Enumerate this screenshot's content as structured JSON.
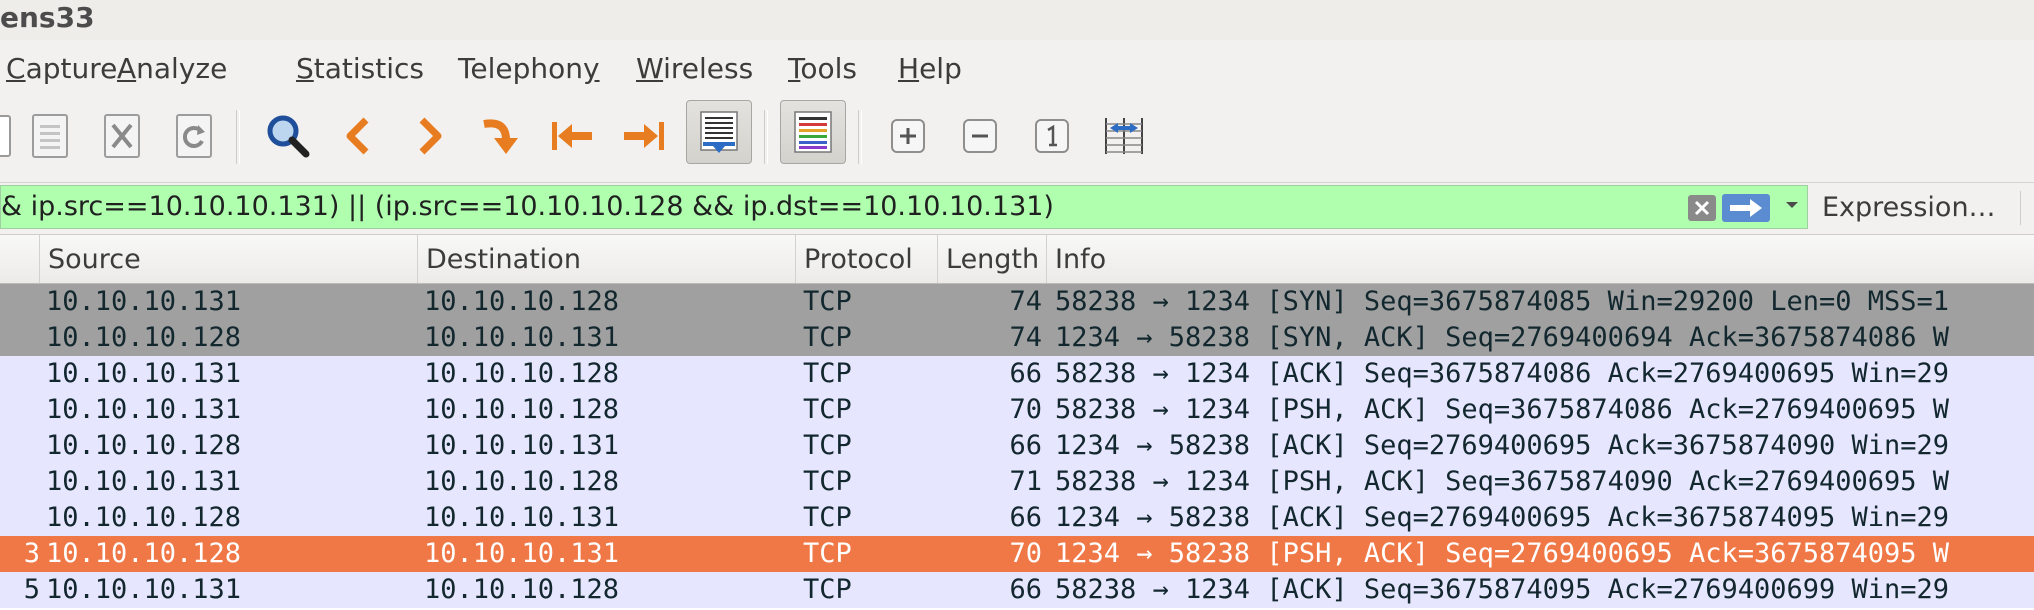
{
  "window": {
    "title": "ens33"
  },
  "menu": [
    {
      "label": "Capture",
      "mnemonic": "C",
      "rest": "apture"
    },
    {
      "label": "Analyze",
      "mnemonic": "A",
      "rest": "nalyze"
    },
    {
      "label": "Statistics",
      "mnemonic": "S",
      "rest": "tatistics"
    },
    {
      "label": "Telephony",
      "mnemonic": "y",
      "rest": "Telephon",
      "mnemonic_last": true
    },
    {
      "label": "Wireless",
      "mnemonic": "W",
      "rest": "ireless"
    },
    {
      "label": "Tools",
      "mnemonic": "T",
      "rest": "ools"
    },
    {
      "label": "Help",
      "mnemonic": "H",
      "rest": "elp"
    }
  ],
  "toolbar": {
    "icons": [
      "open-file-icon",
      "save-file-icon",
      "close-file-icon",
      "reload-icon",
      "find-packet-icon",
      "go-back-icon",
      "go-forward-icon",
      "go-to-packet-icon",
      "first-packet-icon",
      "last-packet-icon",
      "auto-scroll-icon",
      "colorize-icon",
      "zoom-in-icon",
      "zoom-out-icon",
      "normal-size-icon",
      "resize-columns-icon"
    ]
  },
  "filter": {
    "value": "& ip.src==10.10.10.131) || (ip.src==10.10.10.128  && ip.dst==10.10.10.131)",
    "expression_label": "Expression…"
  },
  "columns": {
    "source": "Source",
    "destination": "Destination",
    "protocol": "Protocol",
    "length": "Length",
    "info": "Info"
  },
  "rows": [
    {
      "no": "",
      "source": "10.10.10.131",
      "destination": "10.10.10.128",
      "protocol": "TCP",
      "length": "74",
      "info": "58238 → 1234 [SYN] Seq=3675874085 Win=29200 Len=0 MSS=1",
      "bg": "#a0a0a0",
      "fg": "#12272e"
    },
    {
      "no": "",
      "source": "10.10.10.128",
      "destination": "10.10.10.131",
      "protocol": "TCP",
      "length": "74",
      "info": "1234 → 58238 [SYN, ACK] Seq=2769400694 Ack=3675874086 W",
      "bg": "#a0a0a0",
      "fg": "#12272e"
    },
    {
      "no": "",
      "source": "10.10.10.131",
      "destination": "10.10.10.128",
      "protocol": "TCP",
      "length": "66",
      "info": "58238 → 1234 [ACK] Seq=3675874086 Ack=2769400695 Win=29",
      "bg": "#e7e6ff",
      "fg": "#12272e"
    },
    {
      "no": "",
      "source": "10.10.10.131",
      "destination": "10.10.10.128",
      "protocol": "TCP",
      "length": "70",
      "info": "58238 → 1234 [PSH, ACK] Seq=3675874086 Ack=2769400695 W",
      "bg": "#e7e6ff",
      "fg": "#12272e"
    },
    {
      "no": "",
      "source": "10.10.10.128",
      "destination": "10.10.10.131",
      "protocol": "TCP",
      "length": "66",
      "info": "1234 → 58238 [ACK] Seq=2769400695 Ack=3675874090 Win=29",
      "bg": "#e7e6ff",
      "fg": "#12272e"
    },
    {
      "no": "",
      "source": "10.10.10.131",
      "destination": "10.10.10.128",
      "protocol": "TCP",
      "length": "71",
      "info": "58238 → 1234 [PSH, ACK] Seq=3675874090 Ack=2769400695 W",
      "bg": "#e7e6ff",
      "fg": "#12272e"
    },
    {
      "no": "",
      "source": "10.10.10.128",
      "destination": "10.10.10.131",
      "protocol": "TCP",
      "length": "66",
      "info": "1234 → 58238 [ACK] Seq=2769400695 Ack=3675874095 Win=29",
      "bg": "#e7e6ff",
      "fg": "#12272e"
    },
    {
      "no": "3",
      "source": "10.10.10.128",
      "destination": "10.10.10.131",
      "protocol": "TCP",
      "length": "70",
      "info": "1234 → 58238 [PSH, ACK] Seq=2769400695 Ack=3675874095 W",
      "bg": "#f07746",
      "fg": "#ffffff",
      "selected": true
    },
    {
      "no": "5",
      "source": "10.10.10.131",
      "destination": "10.10.10.128",
      "protocol": "TCP",
      "length": "66",
      "info": "58238 → 1234 [ACK] Seq=3675874095 Ack=2769400699 Win=29",
      "bg": "#e7e6ff",
      "fg": "#12272e"
    }
  ]
}
